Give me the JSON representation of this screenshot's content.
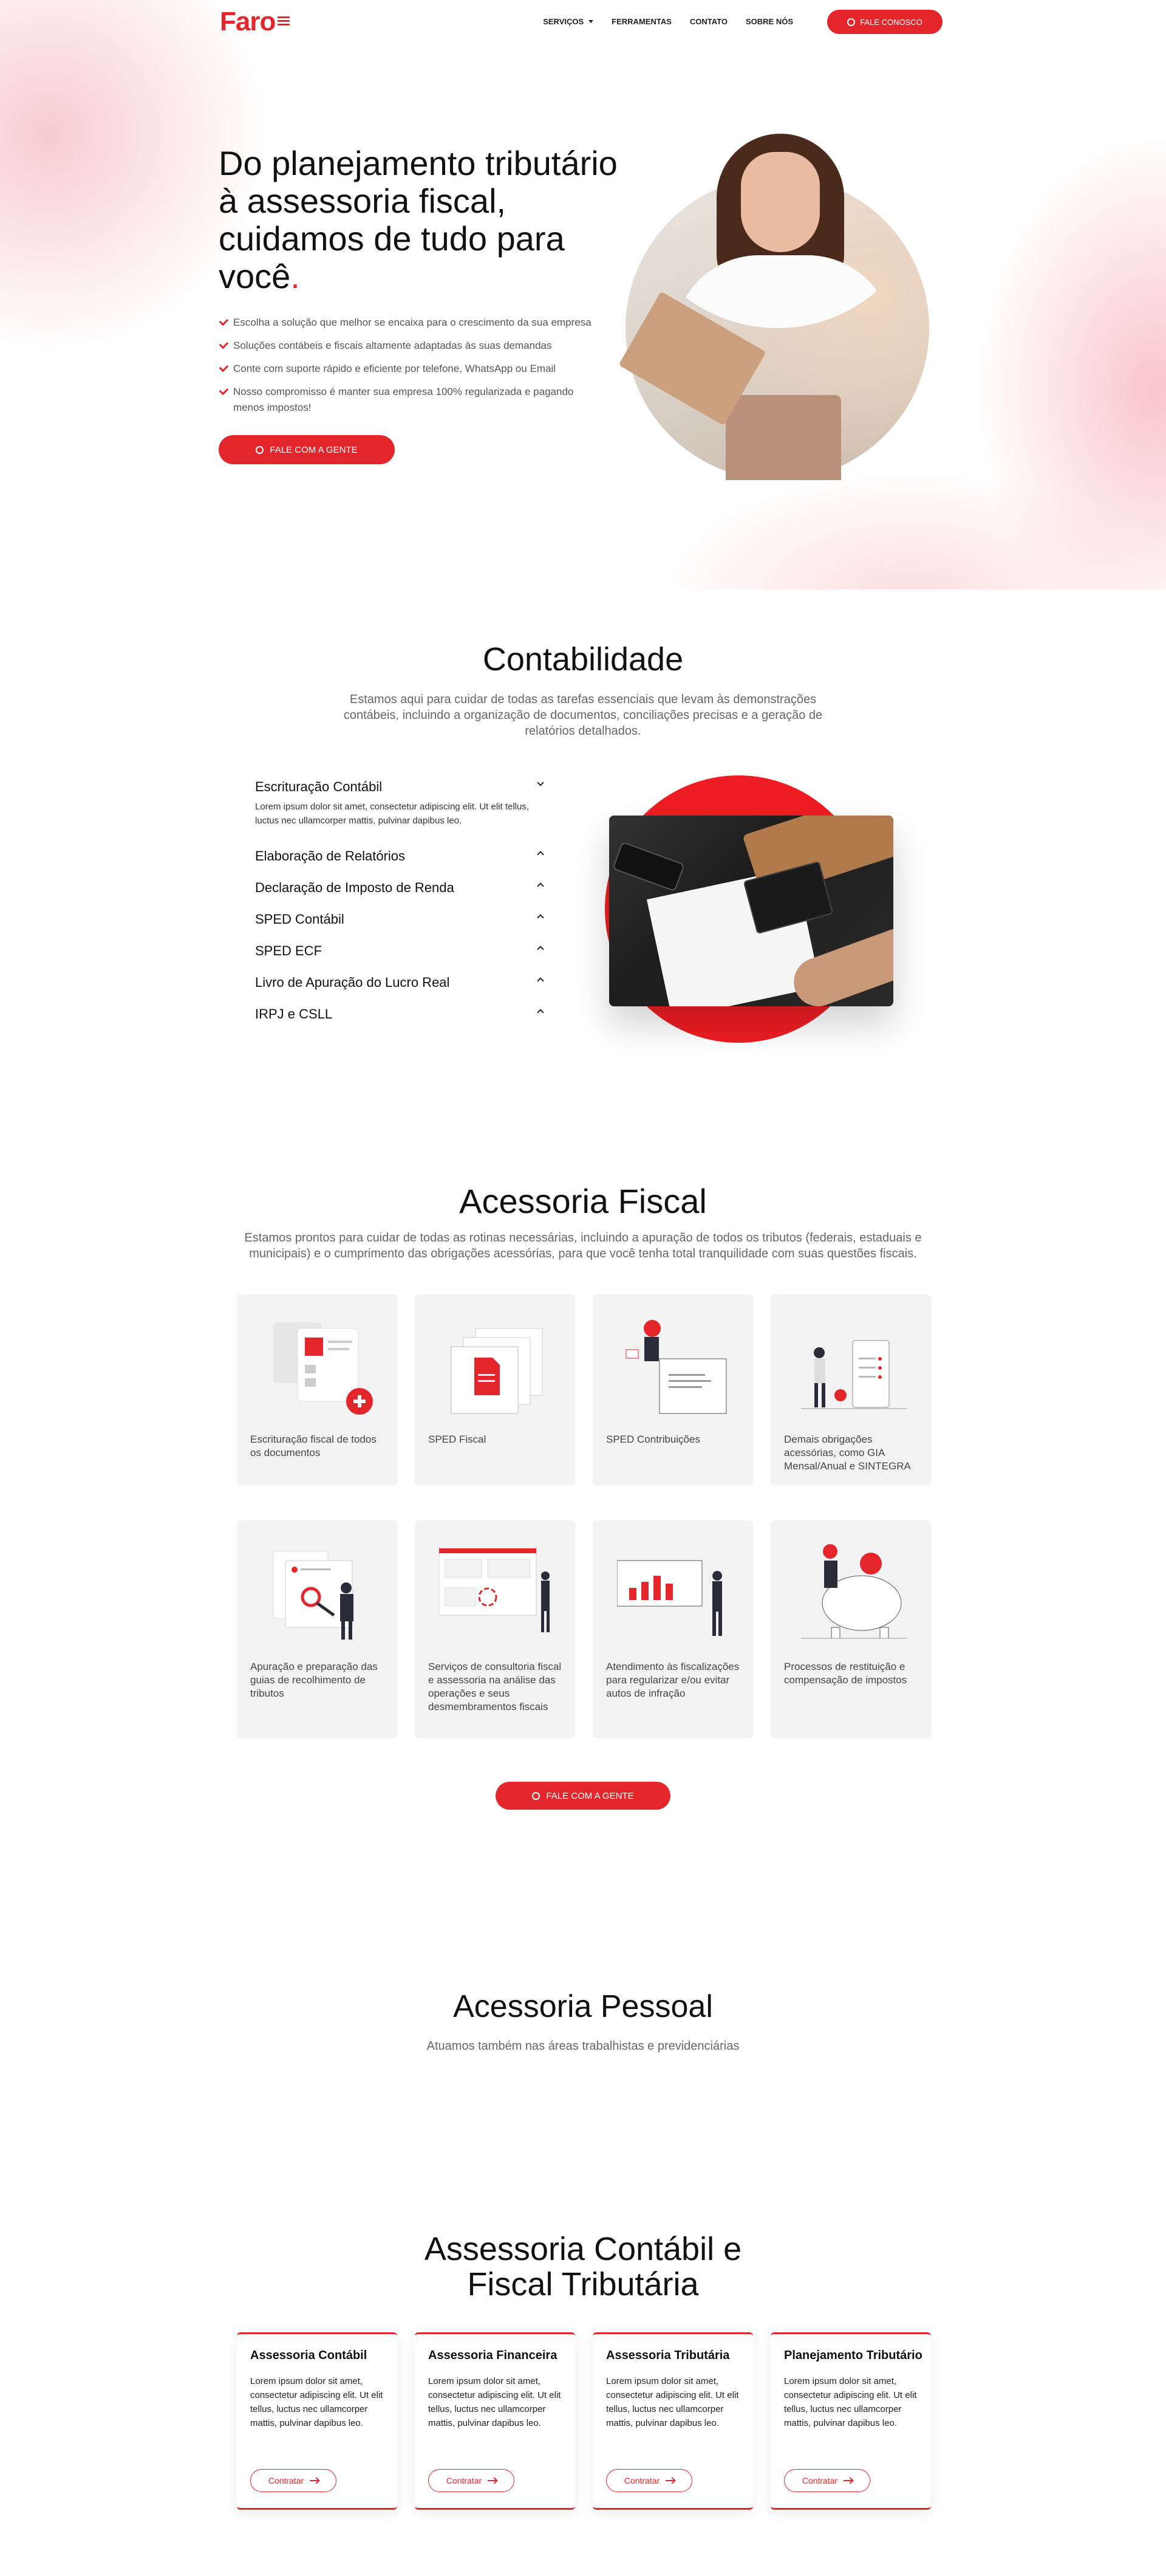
{
  "nav": {
    "logo": "Faro",
    "menu": [
      "SERVIÇOS",
      "FERRAMENTAS",
      "CONTATO",
      "SOBRE NÓS"
    ],
    "cta": "FALE CONOSCO"
  },
  "hero": {
    "title": "Do planejamento tributário à assessoria fiscal, cuidamos de tudo para você",
    "title_dot": ".",
    "checks": [
      "Escolha a solução que melhor se encaixa para o crescimento da sua empresa",
      "Soluções contábeis e fiscais altamente adaptadas às suas demandas",
      "Conte com suporte rápido e eficiente por telefone, WhatsApp ou Email",
      "Nosso compromisso é manter sua empresa 100% regularizada e pagando menos impostos!"
    ],
    "cta": "FALE COM A GENTE"
  },
  "contabilidade": {
    "title": "Contabilidade",
    "subtitle": "Estamos aqui para cuidar de todas as tarefas essenciais que levam às demonstrações contábeis, incluindo a organização de documentos, conciliações precisas e a geração de relatórios detalhados.",
    "items": [
      {
        "label": "Escrituração Contábil",
        "body": "Lorem ipsum dolor sit amet, consectetur adipiscing elit. Ut elit tellus, luctus nec ullamcorper mattis, pulvinar dapibus leo."
      },
      {
        "label": "Elaboração de Relatórios"
      },
      {
        "label": "Declaração de Imposto de Renda"
      },
      {
        "label": "SPED Contábil"
      },
      {
        "label": "SPED ECF"
      },
      {
        "label": "Livro de Apuração do Lucro Real"
      },
      {
        "label": "IRPJ e CSLL"
      }
    ]
  },
  "fiscal": {
    "title": "Acessoria Fiscal",
    "subtitle": "Estamos prontos para cuidar de todas as rotinas necessárias, incluindo a apuração de todos os tributos (federais, estaduais e municipais) e o cumprimento das obrigações acessórias, para que você tenha total tranquilidade com suas questões fiscais.",
    "cards": [
      "Escrituração fiscal de todos os documentos",
      "SPED Fiscal",
      "SPED Contribuições",
      "Demais obrigações acessórias, como GIA Mensal/Anual e SINTEGRA",
      "Apuração e preparação das guias de recolhimento de tributos",
      "Serviços de consultoria fiscal e assessoria na análise das operações e seus desmembramentos fiscais",
      "Atendimento às fiscalizações para regularizar e/ou evitar autos de infração",
      "Processos de restituição e compensação de impostos"
    ],
    "cta": "FALE COM A GENTE"
  },
  "pessoal": {
    "title": "Acessoria Pessoal",
    "subtitle": "Atuamos também nas áreas trabalhistas e previdenciárias"
  },
  "tributaria": {
    "title_line1": "Assessoria Contábil e",
    "title_line2": "Fiscal Tributária",
    "cards": [
      {
        "title": "Assessoria Contábil",
        "text": "Lorem ipsum dolor sit amet, consectetur adipiscing elit. Ut elit tellus, luctus nec ullamcorper mattis, pulvinar dapibus leo.",
        "button": "Contratar"
      },
      {
        "title": "Assessoria Financeira",
        "text": "Lorem ipsum dolor sit amet, consectetur adipiscing elit. Ut elit tellus, luctus nec ullamcorper mattis, pulvinar dapibus leo.",
        "button": "Contratar"
      },
      {
        "title": "Assessoria Tributária",
        "text": "Lorem ipsum dolor sit amet, consectetur adipiscing elit. Ut elit tellus, luctus nec ullamcorper mattis, pulvinar dapibus leo.",
        "button": "Contratar"
      },
      {
        "title": "Planejamento Tributário",
        "text": "Lorem ipsum dolor sit amet, consectetur adipiscing elit. Ut elit tellus, luctus nec ullamcorper mattis, pulvinar dapibus leo.",
        "button": "Contratar"
      }
    ]
  },
  "colors": {
    "accent": "#e3262c",
    "card_bg": "#f3f3f3"
  }
}
